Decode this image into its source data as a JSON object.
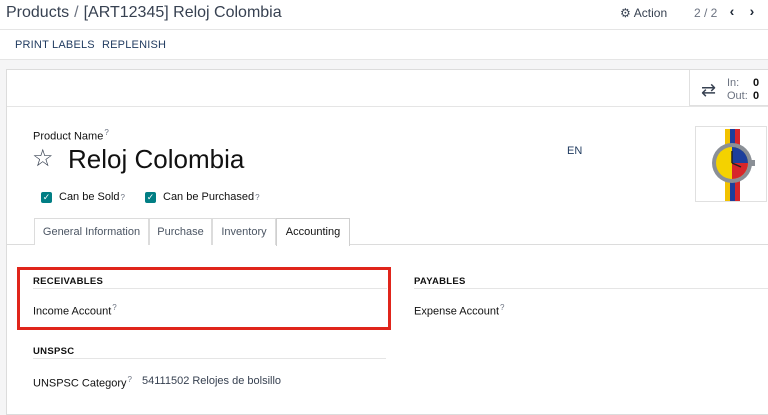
{
  "breadcrumb": {
    "root": "Products",
    "separator": "/",
    "current": "[ART12345] Reloj Colombia"
  },
  "action": {
    "label": "Action",
    "icon": "gear-icon"
  },
  "pager": {
    "value": "2 / 2",
    "prev_icon": "chevron-left-icon",
    "next_icon": "chevron-right-icon"
  },
  "control_buttons": {
    "print_labels": "PRINT LABELS",
    "replenish": "REPLENISH"
  },
  "stat": {
    "in_label": "In:",
    "in_value": "0",
    "out_label": "Out:",
    "out_value": "0"
  },
  "product": {
    "name_label": "Product Name",
    "name": "Reloj Colombia",
    "lang": "EN",
    "can_be_sold": "Can be Sold",
    "can_be_purchased": "Can be Purchased",
    "tooltip_mark": "?"
  },
  "tabs": [
    {
      "label": "General Information"
    },
    {
      "label": "Purchase"
    },
    {
      "label": "Inventory"
    },
    {
      "label": "Accounting"
    }
  ],
  "accounting": {
    "receivables_title": "RECEIVABLES",
    "income_account_label": "Income Account",
    "payables_title": "PAYABLES",
    "expense_account_label": "Expense Account",
    "unspsc_title": "UNSPSC",
    "unspsc_category_label": "UNSPSC Category",
    "unspsc_category_value": "54111502 Relojes de bolsillo"
  },
  "colors": {
    "accent_teal": "#017e84",
    "highlight_red": "#e0251b"
  }
}
